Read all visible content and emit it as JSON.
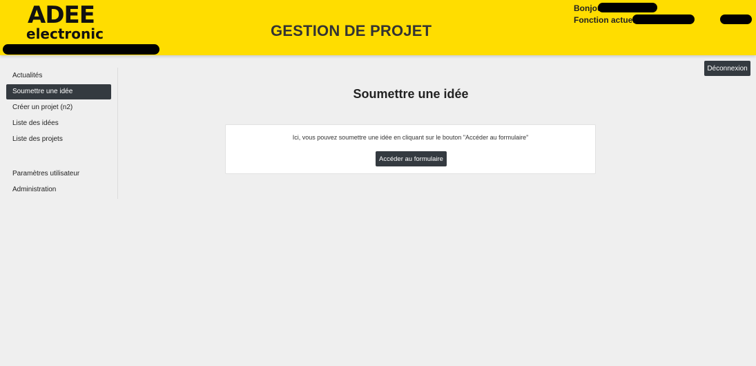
{
  "header": {
    "logo_top": "ADEE",
    "logo_bottom": "electronic",
    "app_title": "GESTION DE PROJET",
    "greeting_label": "Bonjour",
    "role_label": "Fonction actuelle",
    "logout_label": "Déconnexion"
  },
  "sidebar": {
    "items": [
      {
        "label": "Actualités",
        "active": false
      },
      {
        "label": "Soumettre une idée",
        "active": true
      },
      {
        "label": "Créer un projet (n2)",
        "active": false
      },
      {
        "label": "Liste des idées",
        "active": false
      },
      {
        "label": "Liste des projets",
        "active": false
      },
      {
        "label": "Paramètres utilisateur",
        "active": false
      },
      {
        "label": "Administration",
        "active": false
      }
    ]
  },
  "main": {
    "heading": "Soumettre une idée",
    "card_text": "Ici, vous pouvez soumettre une idée en cliquant sur le bouton \"Accéder au formulaire\"",
    "form_button_label": "Accéder au formulaire"
  },
  "colors": {
    "header_bg": "#ffdd00",
    "dark_button": "#343a40",
    "page_bg": "#efefef"
  }
}
